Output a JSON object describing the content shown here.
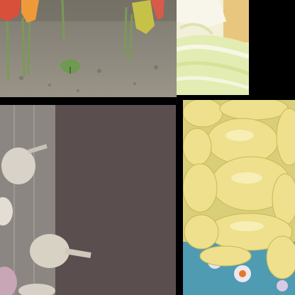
{
  "collage": {
    "tiles": [
      {
        "name": "pepper-seedlings"
      },
      {
        "name": "cabbage-closeup"
      },
      {
        "name": "garlic-bulbs"
      },
      {
        "name": "yellow-peppers"
      }
    ]
  },
  "colors": {
    "background": "#000000",
    "soil": "#8a8476",
    "cabbage": "#e8ebb4",
    "wall": "#5b504f",
    "pepper_yellow": "#eee28b"
  }
}
